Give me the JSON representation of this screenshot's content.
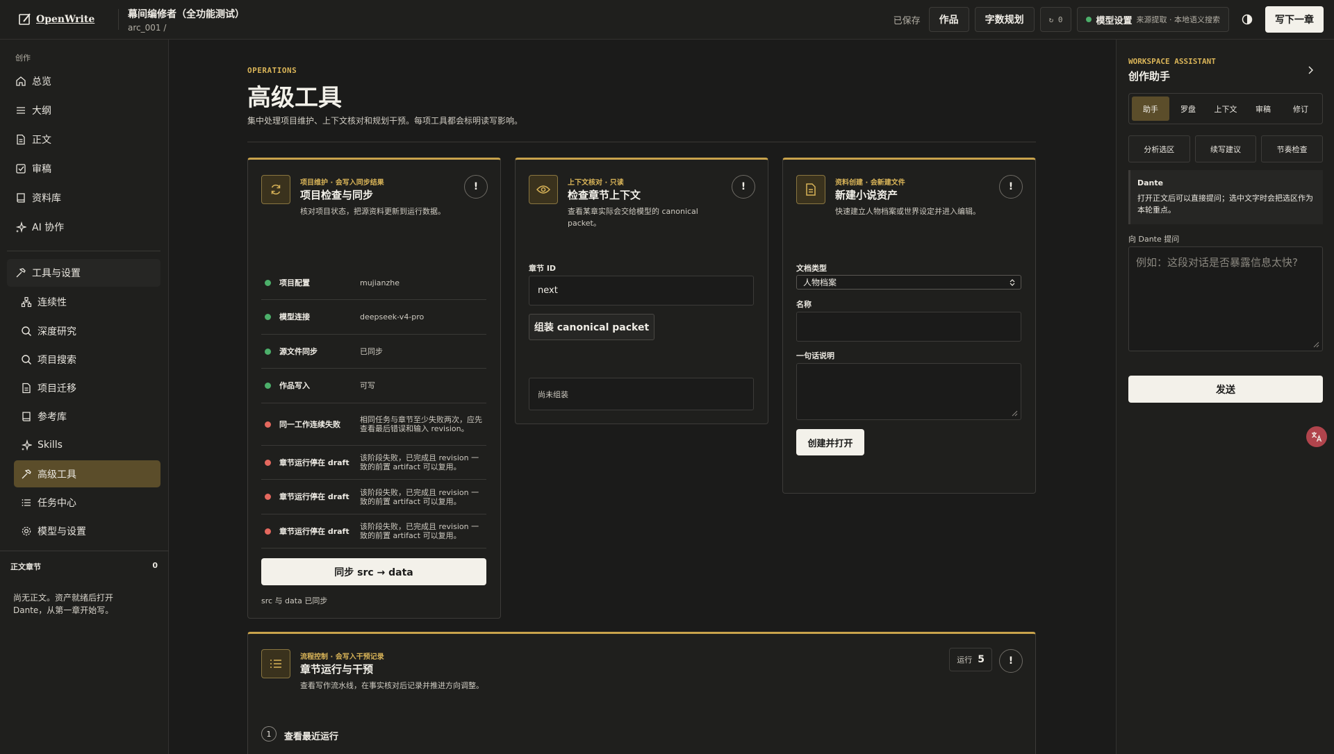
{
  "app": {
    "logo": "OpenWrite",
    "doc_title": "幕间编修者（全功能测试）",
    "doc_path": "arc_001 /"
  },
  "topbar": {
    "saved": "已保存",
    "works": "作品",
    "word_plan": "字数规划",
    "refresh_count": "↻ 0",
    "model_label": "模型设置",
    "model_sub": "来源提取 · 本地语义搜索",
    "write_next": "写下一章"
  },
  "sidebar": {
    "section": "创作",
    "items": [
      "总览",
      "大纲",
      "正文",
      "审稿",
      "资料库",
      "AI 协作"
    ],
    "group": "工具与设置",
    "sub_items": [
      "连续性",
      "深度研究",
      "项目搜索",
      "项目迁移",
      "参考库",
      "Skills",
      "高级工具",
      "任务中心",
      "模型与设置"
    ],
    "chapters_label": "正文章节",
    "chapters_count": "0",
    "chapters_empty": "尚无正文。资产就绪后打开 Dante，从第一章开始写。"
  },
  "main": {
    "eyebrow": "OPERATIONS",
    "title": "高级工具",
    "desc": "集中处理项目维护、上下文核对和规划干预。每项工具都会标明读写影响。",
    "card1": {
      "tag": "项目维护 · 会写入同步结果",
      "title": "项目检查与同步",
      "desc": "核对项目状态，把源资料更新到运行数据。",
      "rows": [
        {
          "label": "项目配置",
          "value": "mujianzhe"
        },
        {
          "label": "模型连接",
          "value": "deepseek-v4-pro"
        },
        {
          "label": "源文件同步",
          "value": "已同步"
        },
        {
          "label": "作品写入",
          "value": "可写"
        },
        {
          "label": "同一工作连续失败",
          "value": "相同任务与章节至少失败两次，应先查看最后错误和输入 revision。"
        },
        {
          "label": "章节运行停在 draft",
          "value": "该阶段失败，已完成且 revision 一致的前置 artifact 可以复用。"
        },
        {
          "label": "章节运行停在 draft",
          "value": "该阶段失败，已完成且 revision 一致的前置 artifact 可以复用。"
        },
        {
          "label": "章节运行停在 draft",
          "value": "该阶段失败，已完成且 revision 一致的前置 artifact 可以复用。"
        }
      ],
      "button": "同步 src → data",
      "note": "src 与 data 已同步"
    },
    "card2": {
      "tag": "上下文核对 · 只读",
      "title": "检查章节上下文",
      "desc": "查看某章实际会交给模型的 canonical packet。",
      "field_label": "章节 ID",
      "field_value": "next",
      "button": "组装 canonical packet",
      "result": "尚未组装"
    },
    "card3": {
      "tag": "资料创建 · 会新建文件",
      "title": "新建小说资产",
      "desc": "快速建立人物档案或世界设定并进入编辑。",
      "type_label": "文档类型",
      "type_value": "人物档案",
      "name_label": "名称",
      "note_label": "一句话说明",
      "button": "创建并打开"
    },
    "card4": {
      "tag": "流程控制 · 会写入干预记录",
      "title": "章节运行与干预",
      "desc": "查看写作流水线，在事实核对后记录并推进方向调整。",
      "run_label": "运行",
      "run_count": "5",
      "step_num": "1",
      "step_label": "查看最近运行"
    }
  },
  "rpanel": {
    "eyebrow": "WORKSPACE ASSISTANT",
    "title": "创作助手",
    "tabs": [
      "助手",
      "罗盘",
      "上下文",
      "审稿",
      "修订"
    ],
    "quick": [
      "分析选区",
      "续写建议",
      "节奏检查"
    ],
    "dante_name": "Dante",
    "dante_msg": "打开正文后可以直接提问；选中文字时会把选区作为本轮重点。",
    "ask_label": "向 Dante 提问",
    "ask_placeholder": "例如：这段对话是否暴露信息太快?",
    "send": "发送"
  },
  "colors": {
    "accent": "#d9b458",
    "active_bg": "#5b4d2a",
    "ok": "#4caf6a",
    "fail": "#e4685e"
  }
}
